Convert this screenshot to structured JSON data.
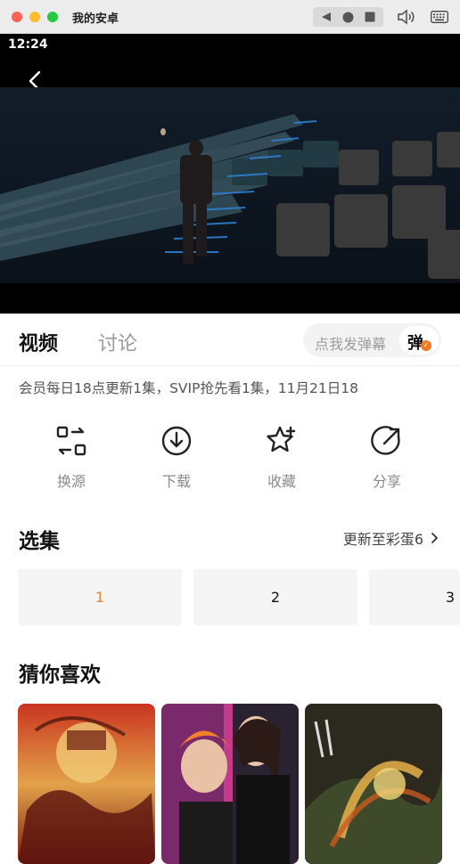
{
  "window": {
    "title": "我的安卓"
  },
  "status": {
    "time": "12:24"
  },
  "tabs": [
    {
      "label": "视频"
    },
    {
      "label": "讨论"
    }
  ],
  "danmu": {
    "placeholder": "点我发弹幕",
    "button": "弹",
    "badge": "✓"
  },
  "notice": "会员每日18点更新1集，SVIP抢先看1集，11月21日18",
  "actions": [
    {
      "label": "换源",
      "icon": "switch-source-icon"
    },
    {
      "label": "下载",
      "icon": "download-icon"
    },
    {
      "label": "收藏",
      "icon": "star-icon"
    },
    {
      "label": "分享",
      "icon": "share-icon"
    }
  ],
  "episodes": {
    "title": "选集",
    "more": "更新至彩蛋6",
    "items": [
      {
        "label": "1",
        "active": true
      },
      {
        "label": "2",
        "active": false
      },
      {
        "label": "3",
        "active": false
      }
    ]
  },
  "recommend": {
    "title": "猜你喜欢"
  },
  "colors": {
    "accent": "#e8872e",
    "badge": "#f07a22"
  }
}
